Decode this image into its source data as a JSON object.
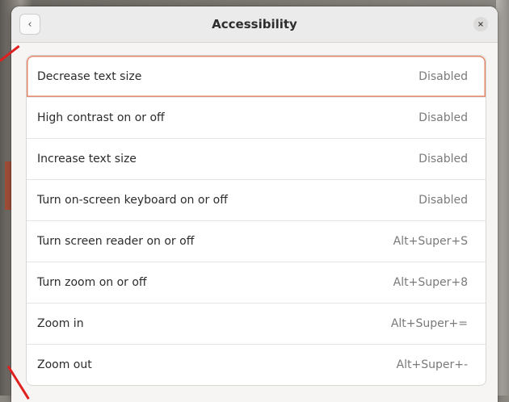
{
  "dialog": {
    "title": "Accessibility",
    "back_icon": "‹",
    "close_icon": "×"
  },
  "shortcuts": [
    {
      "label": "Decrease text size",
      "value": "Disabled"
    },
    {
      "label": "High contrast on or off",
      "value": "Disabled"
    },
    {
      "label": "Increase text size",
      "value": "Disabled"
    },
    {
      "label": "Turn on-screen keyboard on or off",
      "value": "Disabled"
    },
    {
      "label": "Turn screen reader on or off",
      "value": "Alt+Super+S"
    },
    {
      "label": "Turn zoom on or off",
      "value": "Alt+Super+8"
    },
    {
      "label": "Zoom in",
      "value": "Alt+Super+="
    },
    {
      "label": "Zoom out",
      "value": "Alt+Super+-"
    }
  ],
  "colors": {
    "annotation_arrow": "#e0201f",
    "selected_row_outline": "#e4876b"
  }
}
